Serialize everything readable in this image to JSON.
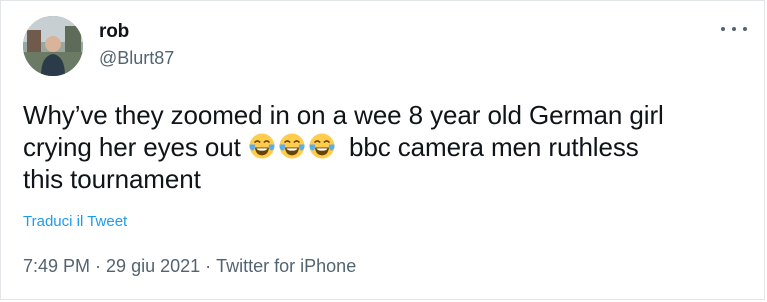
{
  "user": {
    "display_name": "rob",
    "handle": "@Blurt87"
  },
  "tweet": {
    "line1": "Why’ve they zoomed in on a wee 8 year old German girl",
    "line2_prefix": "crying her eyes out",
    "line2_suffix": "bbc camera men ruthless",
    "line3": "this tournament",
    "emoji": [
      "face-with-tears-of-joy",
      "face-with-tears-of-joy",
      "face-with-tears-of-joy"
    ],
    "translate_label": "Traduci il Tweet"
  },
  "meta": {
    "time": "7:49 PM",
    "date": "29 giu 2021",
    "separator": "·",
    "source": "Twitter for iPhone"
  },
  "colors": {
    "primary_text": "#0f1419",
    "secondary_text": "#536471",
    "link": "#1d9bf0"
  },
  "icons": {
    "more": "more-horizontal-icon"
  }
}
